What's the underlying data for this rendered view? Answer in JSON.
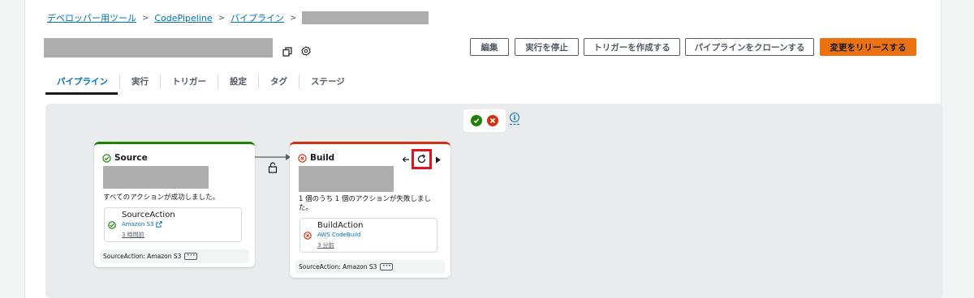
{
  "breadcrumb": {
    "items": [
      "デベロッパー用ツール",
      "CodePipeline",
      "パイプライン"
    ],
    "separator": ">"
  },
  "header": {
    "buttons": {
      "edit": "編集",
      "stop": "実行を停止",
      "create_trigger": "トリガーを作成する",
      "clone": "パイプラインをクローンする",
      "release": "変更をリリースする"
    }
  },
  "tabs": [
    "パイプライン",
    "実行",
    "トリガー",
    "設定",
    "タグ",
    "ステージ"
  ],
  "active_tab": "パイプライン",
  "stages": {
    "source": {
      "name": "Source",
      "status": "succeeded",
      "message": "すべてのアクションが成功しました。",
      "action": {
        "name": "SourceAction",
        "provider": "Amazon S3",
        "time": "3 時間前"
      },
      "footer": "SourceAction: Amazon S3"
    },
    "build": {
      "name": "Build",
      "status": "failed",
      "message_line1": "1 個のうち 1 個のアクションが失敗しまし",
      "message_line2": "た。",
      "action": {
        "name": "BuildAction",
        "provider": "AWS CodeBuild",
        "time": "3 分前"
      },
      "footer": "SourceAction: Amazon S3"
    }
  },
  "icons": {
    "copy": "copy-icon",
    "settings": "gear-icon",
    "success": "check-circle-icon",
    "failure": "x-circle-icon",
    "info": "info-icon",
    "lock": "unlock-icon",
    "retry": "refresh-icon",
    "external": "external-link-icon"
  },
  "colors": {
    "accent": "#0073bb",
    "primary_button": "#ec7211",
    "success": "#1d8102",
    "error": "#d13212",
    "highlight": "#e0131f",
    "redacted": "#adadad"
  }
}
